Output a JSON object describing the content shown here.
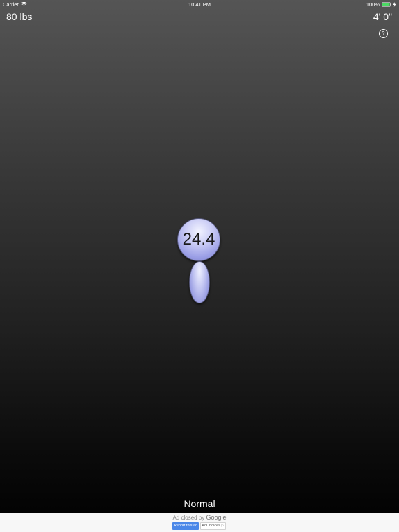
{
  "status_bar": {
    "carrier": "Carrier",
    "time": "10:41 PM",
    "battery": "100%"
  },
  "header": {
    "weight": "80 lbs",
    "height": "4' 0\"",
    "help_icon": "?"
  },
  "figure": {
    "bmi": "24.4"
  },
  "category": "Normal",
  "ad": {
    "closed_by": "Ad closed by",
    "brand": "Google",
    "report_label": "Report this ad",
    "adchoices_label": "AdChoices",
    "adchoices_icon": "▷"
  },
  "colors": {
    "figure_fill": "#a8acec",
    "ad_button": "#4a87e8"
  }
}
